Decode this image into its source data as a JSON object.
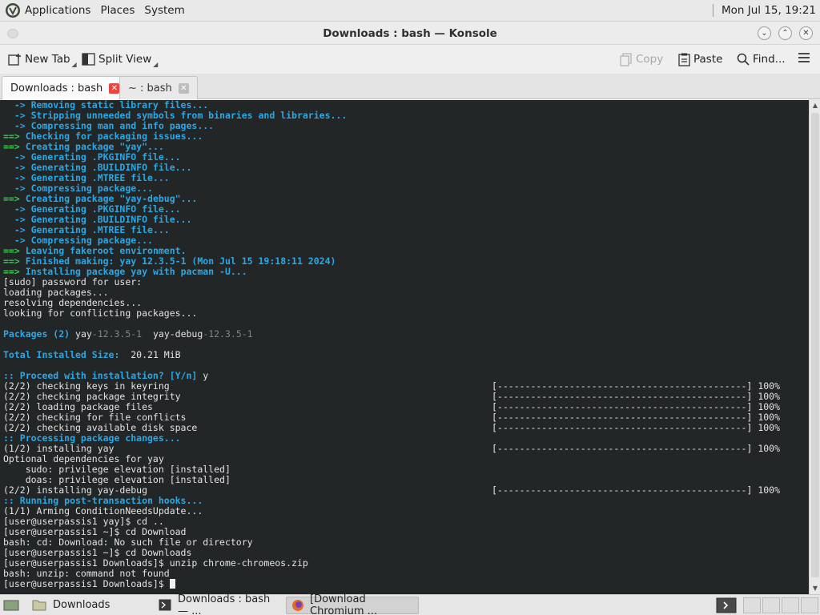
{
  "top_panel": {
    "menus": [
      "Applications",
      "Places",
      "System"
    ],
    "clock": "Mon Jul 15, 19:21"
  },
  "window": {
    "title": "Downloads : bash — Konsole"
  },
  "toolbar": {
    "new_tab": "New Tab",
    "split_view": "Split View",
    "copy": "Copy",
    "paste": "Paste",
    "find": "Find..."
  },
  "tabs": [
    {
      "label": "Downloads : bash",
      "active": true
    },
    {
      "label": "~ : bash",
      "active": false
    }
  ],
  "terminal": {
    "lines": [
      [
        {
          "t": "  -> Removing static library files...",
          "c": "c-cyan"
        }
      ],
      [
        {
          "t": "  -> Stripping unneeded symbols from binaries and libraries...",
          "c": "c-cyan"
        }
      ],
      [
        {
          "t": "  -> Compressing man and info pages...",
          "c": "c-cyan"
        }
      ],
      [
        {
          "t": "==> ",
          "c": "c-green"
        },
        {
          "t": "Checking for packaging issues...",
          "c": "c-cyan"
        }
      ],
      [
        {
          "t": "==> ",
          "c": "c-green"
        },
        {
          "t": "Creating package \"yay\"...",
          "c": "c-cyan"
        }
      ],
      [
        {
          "t": "  -> Generating .PKGINFO file...",
          "c": "c-cyan"
        }
      ],
      [
        {
          "t": "  -> Generating .BUILDINFO file...",
          "c": "c-cyan"
        }
      ],
      [
        {
          "t": "  -> Generating .MTREE file...",
          "c": "c-cyan"
        }
      ],
      [
        {
          "t": "  -> Compressing package...",
          "c": "c-cyan"
        }
      ],
      [
        {
          "t": "==> ",
          "c": "c-green"
        },
        {
          "t": "Creating package \"yay-debug\"...",
          "c": "c-cyan"
        }
      ],
      [
        {
          "t": "  -> Generating .PKGINFO file...",
          "c": "c-cyan"
        }
      ],
      [
        {
          "t": "  -> Generating .BUILDINFO file...",
          "c": "c-cyan"
        }
      ],
      [
        {
          "t": "  -> Generating .MTREE file...",
          "c": "c-cyan"
        }
      ],
      [
        {
          "t": "  -> Compressing package...",
          "c": "c-cyan"
        }
      ],
      [
        {
          "t": "==> ",
          "c": "c-green"
        },
        {
          "t": "Leaving fakeroot environment.",
          "c": "c-cyan"
        }
      ],
      [
        {
          "t": "==> ",
          "c": "c-green"
        },
        {
          "t": "Finished making: yay 12.3.5-1 (Mon Jul 15 19:18:11 2024)",
          "c": "c-cyan"
        }
      ],
      [
        {
          "t": "==> ",
          "c": "c-green"
        },
        {
          "t": "Installing package yay with pacman -U...",
          "c": "c-cyan"
        }
      ],
      [
        {
          "t": "[sudo] password for user:",
          "c": "c-white"
        }
      ],
      [
        {
          "t": "loading packages...",
          "c": "c-white"
        }
      ],
      [
        {
          "t": "resolving dependencies...",
          "c": "c-white"
        }
      ],
      [
        {
          "t": "looking for conflicting packages...",
          "c": "c-white"
        }
      ],
      [],
      [
        {
          "t": "Packages (2) ",
          "c": "c-cyan"
        },
        {
          "t": "yay",
          "c": "c-white"
        },
        {
          "t": "-12.3.5-1  ",
          "c": "c-dim"
        },
        {
          "t": "yay-debug",
          "c": "c-white"
        },
        {
          "t": "-12.3.5-1",
          "c": "c-dim"
        }
      ],
      [],
      [
        {
          "t": "Total Installed Size:  ",
          "c": "c-cyan"
        },
        {
          "t": "20.21 MiB",
          "c": "c-white"
        }
      ],
      [],
      [
        {
          "t": ":: Proceed with installation? [Y/n] ",
          "c": "c-cyan"
        },
        {
          "t": "y",
          "c": "c-white"
        }
      ],
      [
        {
          "t": "(2/2) checking keys in keyring",
          "c": "c-white"
        }
      ],
      [
        {
          "t": "(2/2) checking package integrity",
          "c": "c-white"
        }
      ],
      [
        {
          "t": "(2/2) loading package files",
          "c": "c-white"
        }
      ],
      [
        {
          "t": "(2/2) checking for file conflicts",
          "c": "c-white"
        }
      ],
      [
        {
          "t": "(2/2) checking available disk space",
          "c": "c-white"
        }
      ],
      [
        {
          "t": ":: Processing package changes...",
          "c": "c-cyan"
        }
      ],
      [
        {
          "t": "(1/2) installing yay",
          "c": "c-white"
        }
      ],
      [
        {
          "t": "Optional dependencies for yay",
          "c": "c-white"
        }
      ],
      [
        {
          "t": "    sudo: privilege elevation [installed]",
          "c": "c-white"
        }
      ],
      [
        {
          "t": "    doas: privilege elevation [installed]",
          "c": "c-white"
        }
      ],
      [
        {
          "t": "(2/2) installing yay-debug",
          "c": "c-white"
        }
      ],
      [
        {
          "t": ":: Running post-transaction hooks...",
          "c": "c-cyan"
        }
      ],
      [
        {
          "t": "(1/1) Arming ConditionNeedsUpdate...",
          "c": "c-white"
        }
      ],
      [
        {
          "t": "[user@userpassis1 yay]$ cd ..",
          "c": "c-white"
        }
      ],
      [
        {
          "t": "[user@userpassis1 ~]$ cd Download",
          "c": "c-white"
        }
      ],
      [
        {
          "t": "bash: cd: Download: No such file or directory",
          "c": "c-white"
        }
      ],
      [
        {
          "t": "[user@userpassis1 ~]$ cd Downloads",
          "c": "c-white"
        }
      ],
      [
        {
          "t": "[user@userpassis1 Downloads]$ unzip chrome-chromeos.zip",
          "c": "c-white"
        }
      ],
      [
        {
          "t": "bash: unzip: command not found",
          "c": "c-white"
        }
      ],
      [
        {
          "t": "[user@userpassis1 Downloads]$ ",
          "c": "c-white"
        }
      ]
    ],
    "progress_bars": [
      {
        "line": 27,
        "text": "[---------------------------------------------] 100%"
      },
      {
        "line": 28,
        "text": "[---------------------------------------------] 100%"
      },
      {
        "line": 29,
        "text": "[---------------------------------------------] 100%"
      },
      {
        "line": 30,
        "text": "[---------------------------------------------] 100%"
      },
      {
        "line": 31,
        "text": "[---------------------------------------------] 100%"
      },
      {
        "line": 33,
        "text": "[---------------------------------------------] 100%"
      },
      {
        "line": 37,
        "text": "[---------------------------------------------] 100%"
      }
    ]
  },
  "taskbar": {
    "tasks": [
      {
        "label": "Downloads",
        "icon": "folder-icon"
      },
      {
        "label": "Downloads : bash — ...",
        "icon": "terminal-icon"
      },
      {
        "label": "[Download Chromium ...",
        "icon": "firefox-icon",
        "active": true
      }
    ]
  }
}
